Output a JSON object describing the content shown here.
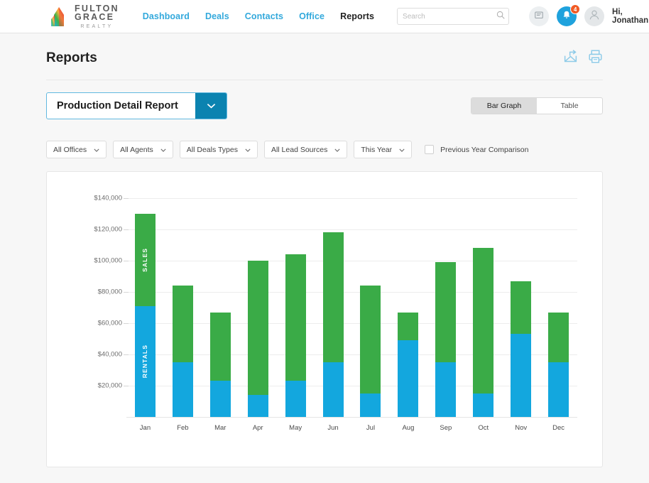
{
  "nav": {
    "brand": {
      "name": "FULTON GRACE",
      "sub": "REALTY"
    },
    "menu": [
      {
        "label": "Dashboard",
        "active": false
      },
      {
        "label": "Deals",
        "active": false
      },
      {
        "label": "Contacts",
        "active": false
      },
      {
        "label": "Office",
        "active": false
      },
      {
        "label": "Reports",
        "active": true
      }
    ],
    "search": {
      "value": "",
      "placeholder": "Search"
    },
    "messages_icon": "message-icon",
    "notifications_icon": "bell-icon",
    "notification_count": "4",
    "avatar_icon": "user-avatar-icon",
    "greeting": "Hi, Jonathan",
    "greeting_caret": "chevron-down-icon"
  },
  "page": {
    "title": "Reports",
    "share_icon": "share-export-icon",
    "print_icon": "printer-icon"
  },
  "report_selector": {
    "value": "Production Detail Report",
    "caret_icon": "chevron-down-icon"
  },
  "view_toggle": {
    "options": [
      {
        "label": "Bar Graph",
        "selected": true
      },
      {
        "label": "Table",
        "selected": false
      }
    ]
  },
  "filters": [
    {
      "label": "All Offices"
    },
    {
      "label": "All Agents"
    },
    {
      "label": "All Deals Types"
    },
    {
      "label": "All Lead Sources"
    },
    {
      "label": "This Year"
    }
  ],
  "comparison_checkbox": {
    "label": "Previous Year Comparison",
    "checked": false
  },
  "colors": {
    "sales": "#3aab47",
    "rentals": "#13a7de",
    "nav_link": "#33a9dc",
    "select_button": "#0b83b0",
    "badge": "#f15a24"
  },
  "chart_data": {
    "type": "bar",
    "stacked": true,
    "title": "Production Detail Report",
    "xlabel": "",
    "ylabel": "",
    "grid": true,
    "legend_position": "in-bar",
    "ylim": [
      0,
      140000
    ],
    "ytick_labels": [
      "$20,000",
      "$40,000",
      "$60,000",
      "$80,000",
      "$100,000",
      "$120,000",
      "$140,000"
    ],
    "ytick_values": [
      20000,
      40000,
      60000,
      80000,
      100000,
      120000,
      140000
    ],
    "categories": [
      "Jan",
      "Feb",
      "Mar",
      "Apr",
      "May",
      "Jun",
      "Jul",
      "Aug",
      "Sep",
      "Oct",
      "Nov",
      "Dec"
    ],
    "series": [
      {
        "name": "RENTALS",
        "color": "#13a7de",
        "values": [
          71000,
          35000,
          23000,
          14000,
          23000,
          35000,
          15000,
          49000,
          35000,
          15000,
          53000,
          35000
        ]
      },
      {
        "name": "SALES",
        "color": "#3aab47",
        "values": [
          59000,
          49000,
          44000,
          86000,
          81000,
          83000,
          69000,
          18000,
          64000,
          93000,
          34000,
          32000
        ]
      }
    ],
    "totals": [
      130000,
      84000,
      67000,
      100000,
      104000,
      118000,
      84000,
      67000,
      99000,
      108000,
      87000,
      67000
    ]
  }
}
